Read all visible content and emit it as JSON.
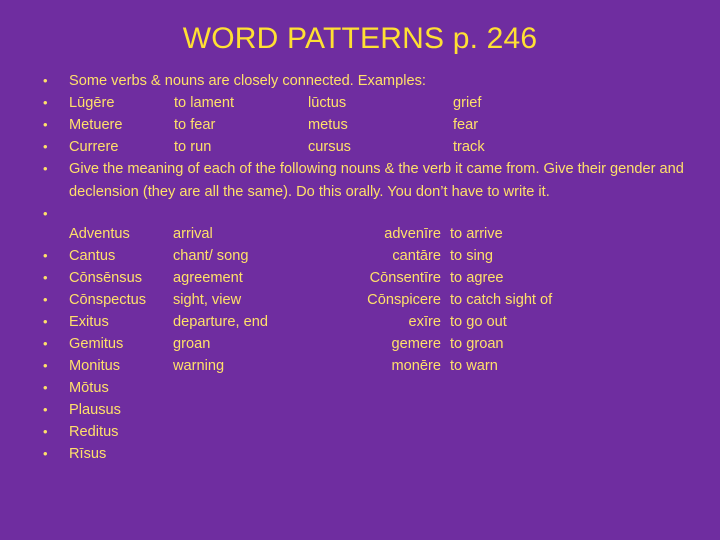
{
  "slide": {
    "title": "WORD PATTERNS p. 246",
    "background_color": "#6F2DA0",
    "title_color": "#FFE033",
    "body_color": "#FFE06A",
    "intro": "Some verbs & nouns are closely connected. Examples:",
    "examples": [
      {
        "verb": "Lūgēre",
        "verb_meaning": "to lament",
        "noun": "lūctus",
        "noun_meaning": "grief"
      },
      {
        "verb": "Metuere",
        "verb_meaning": " to fear",
        "noun": "metus",
        "noun_meaning": "fear"
      },
      {
        "verb": "Currere",
        "verb_meaning": "to run",
        "noun": "cursus",
        "noun_meaning": "track"
      }
    ],
    "instruction": "Give the meaning of each of the following nouns & the verb it came from. Give their gender and declension (they are all the same). Do this orally. You don’t have to write it.",
    "vocabulary": [
      {
        "noun": "Adventus",
        "noun_meaning": "arrival",
        "verb": "advenīre",
        "verb_meaning": "to arrive",
        "bullet": false
      },
      {
        "noun": "Cantus",
        "noun_meaning": "chant/ song",
        "verb": "cantāre",
        "verb_meaning": " to sing",
        "bullet": true
      },
      {
        "noun": "Cōnsēnsus",
        "noun_meaning": "agreement",
        "verb": "Cōnsentīre",
        "verb_meaning": "to agree",
        "bullet": true
      },
      {
        "noun": "Cōnspectus",
        "noun_meaning": "sight, view",
        "verb": "Cōnspicere",
        "verb_meaning": "to catch sight of",
        "bullet": true
      },
      {
        "noun": "Exitus",
        "noun_meaning": "departure, end",
        "verb": "exīre",
        "verb_meaning": "to go out",
        "bullet": true
      },
      {
        "noun": "Gemitus",
        "noun_meaning": "groan",
        "verb": "gemere",
        "verb_meaning": "to groan",
        "bullet": true
      },
      {
        "noun": "Monitus",
        "noun_meaning": "warning",
        "verb": "monēre",
        "verb_meaning": "to warn",
        "bullet": true
      },
      {
        "noun": "Mōtus",
        "noun_meaning": "",
        "verb": "",
        "verb_meaning": "",
        "bullet": true
      },
      {
        "noun": "Plausus",
        "noun_meaning": "",
        "verb": "",
        "verb_meaning": "",
        "bullet": true
      },
      {
        "noun": "Reditus",
        "noun_meaning": "",
        "verb": "",
        "verb_meaning": "",
        "bullet": true
      },
      {
        "noun": "Rīsus",
        "noun_meaning": "",
        "verb": "",
        "verb_meaning": "",
        "bullet": true
      }
    ],
    "bullet_glyph": "•"
  }
}
